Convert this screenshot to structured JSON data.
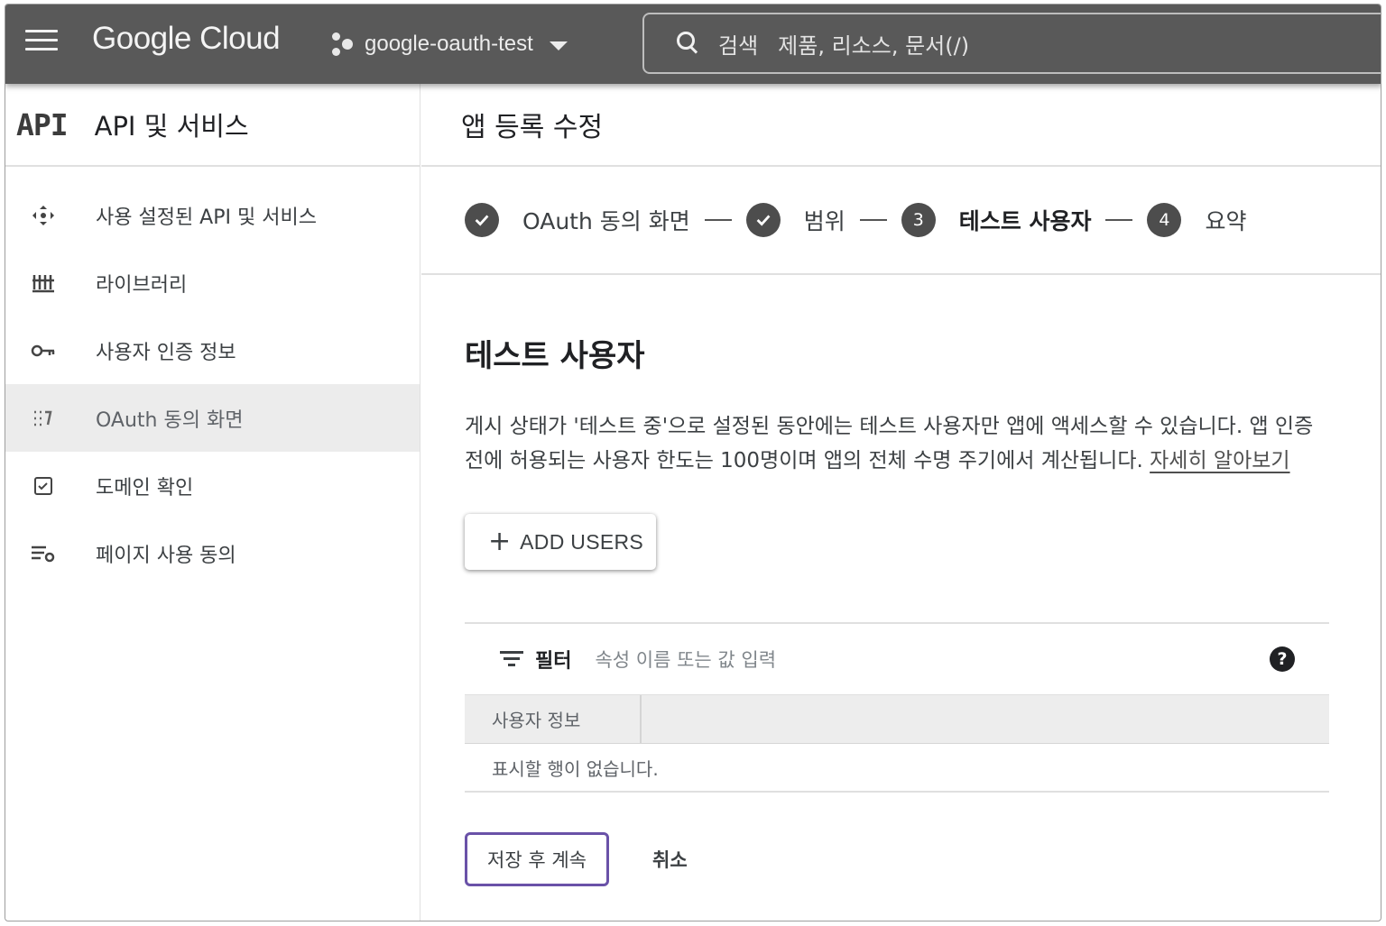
{
  "topbar": {
    "brand": "Google Cloud",
    "project": "google-oauth-test",
    "search_label": "검색",
    "search_placeholder": "제품, 리소스, 문서(/)"
  },
  "sidebar": {
    "logo": "API",
    "title": "API 및 서비스",
    "items": [
      {
        "label": "사용 설정된 API 및 서비스",
        "icon": "api-hub-icon"
      },
      {
        "label": "라이브러리",
        "icon": "library-icon"
      },
      {
        "label": "사용자 인증 정보",
        "icon": "key-icon"
      },
      {
        "label": "OAuth 동의 화면",
        "icon": "consent-screen-icon",
        "active": true
      },
      {
        "label": "도메인 확인",
        "icon": "checkbox-icon"
      },
      {
        "label": "페이지 사용 동의",
        "icon": "settings-list-icon"
      }
    ]
  },
  "main": {
    "title": "앱 등록 수정",
    "steps": [
      {
        "label": "OAuth 동의 화면",
        "state": "done"
      },
      {
        "label": "범위",
        "state": "done"
      },
      {
        "label": "테스트 사용자",
        "state": "current",
        "number": "3"
      },
      {
        "label": "요약",
        "state": "pending",
        "number": "4"
      }
    ],
    "section_title": "테스트 사용자",
    "description": "게시 상태가 '테스트 중'으로 설정된 동안에는 테스트 사용자만 앱에 액세스할 수 있습니다. 앱 인증 전에 허용되는 사용자 한도는 100명이며 앱의 전체 수명 주기에서 계산됩니다.",
    "learn_more": "자세히 알아보기",
    "add_users": "ADD USERS",
    "filter_label": "필터",
    "filter_placeholder": "속성 이름 또는 값 입력",
    "table_header": "사용자 정보",
    "empty_text": "표시할 행이 없습니다.",
    "save_button": "저장 후 계속",
    "cancel_button": "취소"
  },
  "colors": {
    "topbar": "#595959",
    "save_outline": "#6a52a8"
  }
}
